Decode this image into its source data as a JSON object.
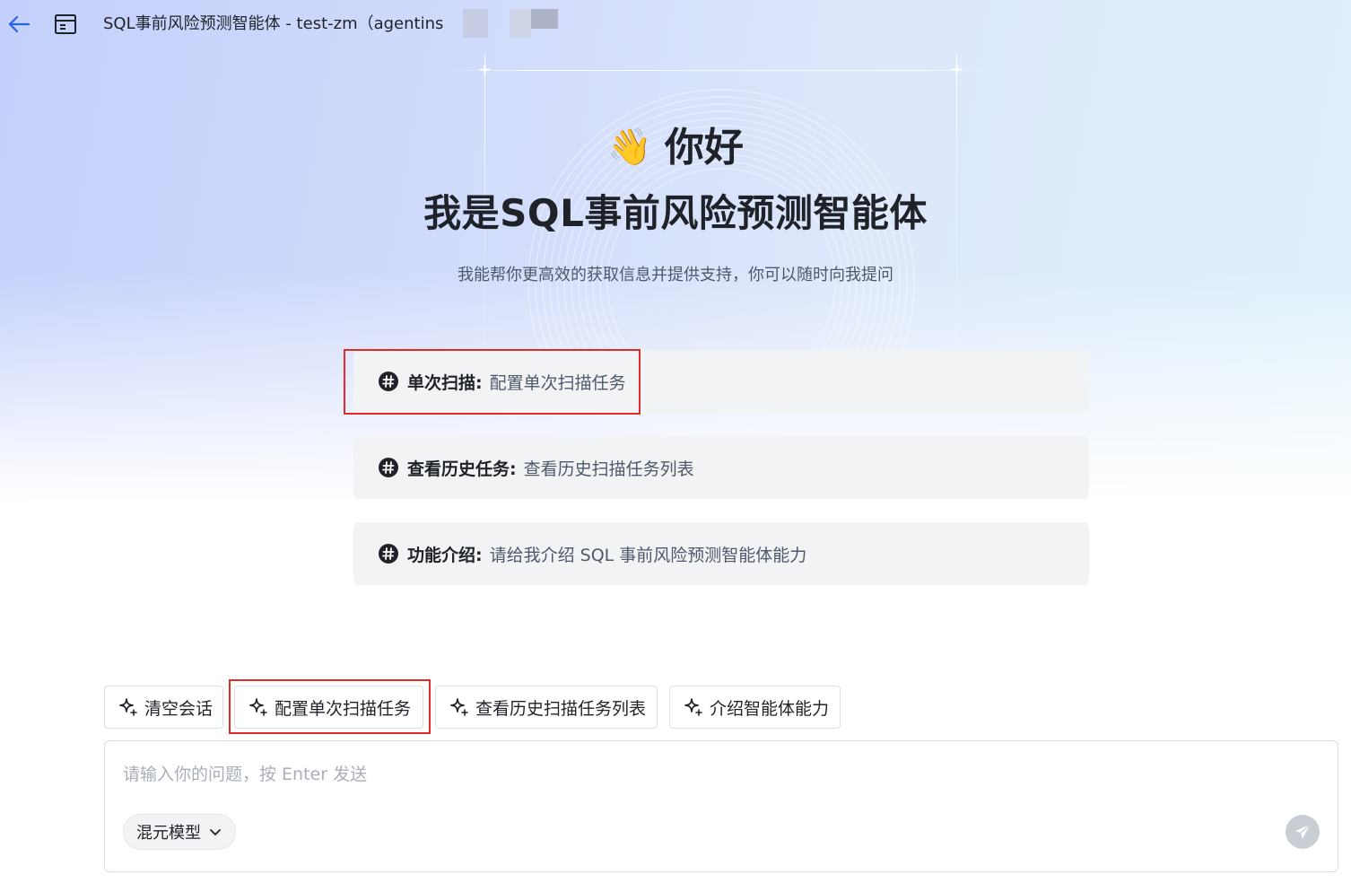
{
  "header": {
    "title": "SQL事前风险预测智能体 - test-zm（agentins"
  },
  "greeting": {
    "hello": "你好",
    "wave_emoji": "👋",
    "intro": "我是SQL事前风险预测智能体",
    "subtitle": "我能帮你更高效的获取信息并提供支持，你可以随时向我提问"
  },
  "suggestions": [
    {
      "key": "单次扫描:",
      "text": "配置单次扫描任务"
    },
    {
      "key": "查看历史任务:",
      "text": "查看历史扫描任务列表"
    },
    {
      "key": "功能介绍:",
      "text": "请给我介绍 SQL 事前风险预测智能体能力"
    }
  ],
  "quick_actions": [
    {
      "label": "清空会话"
    },
    {
      "label": "配置单次扫描任务"
    },
    {
      "label": "查看历史扫描任务列表"
    },
    {
      "label": "介绍智能体能力"
    }
  ],
  "input": {
    "placeholder": "请输入你的问题，按 Enter 发送",
    "model_label": "混元模型"
  },
  "icons": {
    "back": "arrow-left-icon",
    "sidebar": "sidebar-toggle-icon",
    "hash": "hash-icon",
    "sparkle": "sparkle-icon",
    "chevron": "chevron-down-icon",
    "send": "send-icon"
  },
  "colors": {
    "accent": "#2563eb",
    "highlight_border": "#e02b2b",
    "card_bg": "#f2f3f5",
    "send_disabled": "#c9cdd4"
  }
}
